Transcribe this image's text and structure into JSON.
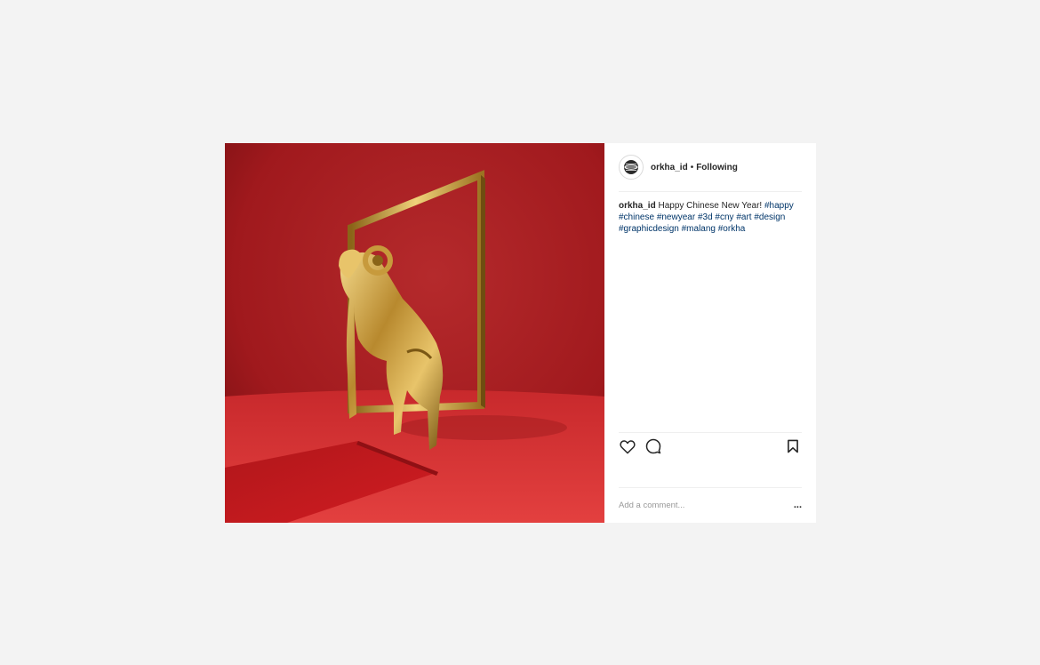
{
  "post": {
    "image_alt": "Golden ram figure stepping through a golden frame onto a red carpet against a red background",
    "header": {
      "username": "orkha_id",
      "separator": "•",
      "follow_status": "Following",
      "avatar_icon": "globe-logo-icon"
    },
    "caption": {
      "username": "orkha_id",
      "text": "Happy Chinese New Year!",
      "hashtags": [
        "#happy",
        "#chinese",
        "#newyear",
        "#3d",
        "#cny",
        "#art",
        "#design",
        "#graphicdesign",
        "#malang",
        "#orkha"
      ]
    },
    "actions": {
      "like_icon": "heart-outline-icon",
      "comment_icon": "speech-bubble-icon",
      "save_icon": "bookmark-outline-icon"
    },
    "comment": {
      "placeholder": "Add a comment...",
      "more_label": "..."
    }
  },
  "colors": {
    "page_background": "#f3f3f3",
    "panel_background": "#ffffff",
    "text": "#262626",
    "hashtag": "#003569",
    "placeholder": "#999999",
    "image_red": "#c9272b"
  }
}
